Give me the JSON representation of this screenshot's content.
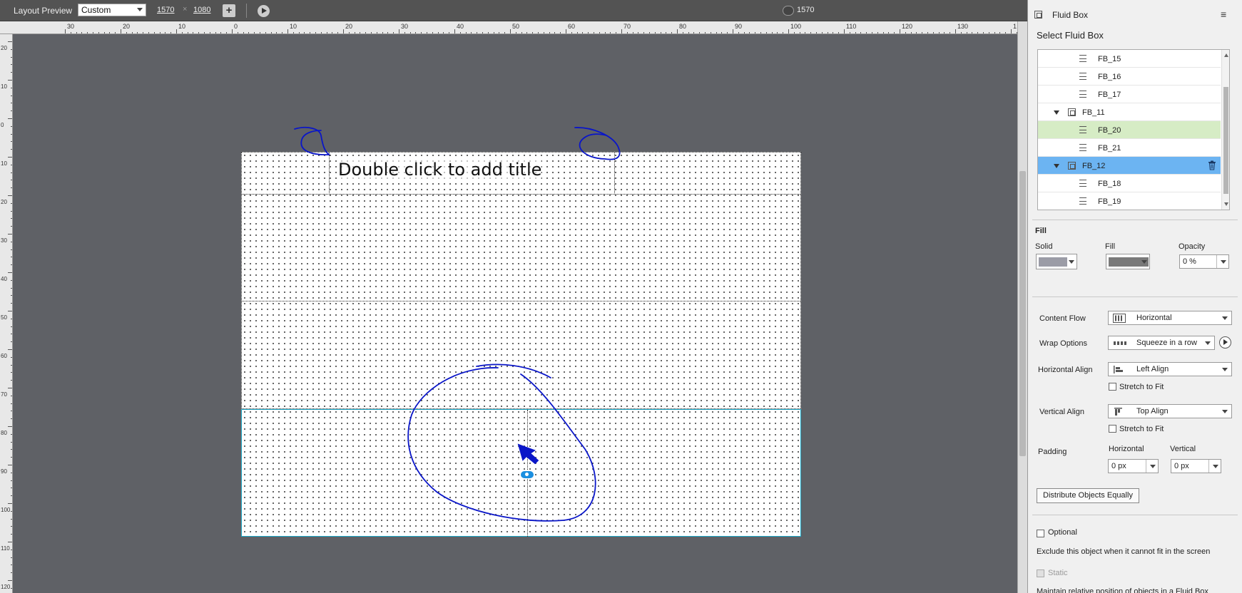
{
  "toolbar": {
    "label": "Layout Preview",
    "preset": "Custom",
    "width": "1570",
    "height": "1080",
    "separator": "×",
    "preview_width": "1570"
  },
  "rulers": {
    "top": [
      "30",
      "20",
      "10",
      "0",
      "10",
      "20",
      "30",
      "40",
      "50",
      "60",
      "70",
      "80",
      "90",
      "100",
      "110",
      "120",
      "130",
      "1"
    ],
    "left": [
      "20",
      "10",
      "0",
      "10",
      "20",
      "30",
      "40",
      "50",
      "60",
      "70",
      "80",
      "90",
      "100",
      "110",
      "120"
    ]
  },
  "canvas": {
    "title_placeholder": "Double click to add title"
  },
  "panel": {
    "title": "Fluid Box",
    "section_title": "Select Fluid Box",
    "tree": [
      {
        "label": "FB_15",
        "level": 2,
        "type": "row"
      },
      {
        "label": "FB_16",
        "level": 2,
        "type": "row"
      },
      {
        "label": "FB_17",
        "level": 2,
        "type": "row"
      },
      {
        "label": "FB_11",
        "level": 1,
        "type": "box",
        "expanded": true
      },
      {
        "label": "FB_20",
        "level": 2,
        "type": "row",
        "highlighted": true
      },
      {
        "label": "FB_21",
        "level": 2,
        "type": "row"
      },
      {
        "label": "FB_12",
        "level": 1,
        "type": "box",
        "expanded": true,
        "selected": true
      },
      {
        "label": "FB_18",
        "level": 2,
        "type": "row"
      },
      {
        "label": "FB_19",
        "level": 2,
        "type": "row"
      }
    ],
    "fill": {
      "heading": "Fill",
      "solid_label": "Solid",
      "fill_label": "Fill",
      "opacity_label": "Opacity",
      "opacity_value": "0 %",
      "solid_color": "#9b9ca6",
      "fill_color": "#7a7a7a"
    },
    "content_flow": {
      "label": "Content Flow",
      "value": "Horizontal"
    },
    "wrap_options": {
      "label": "Wrap Options",
      "value": "Squeeze in a row"
    },
    "horizontal_align": {
      "label": "Horizontal Align",
      "value": "Left Align",
      "stretch": "Stretch to Fit"
    },
    "vertical_align": {
      "label": "Vertical Align",
      "value": "Top Align",
      "stretch": "Stretch to Fit"
    },
    "padding": {
      "label": "Padding",
      "horizontal_label": "Horizontal",
      "vertical_label": "Vertical",
      "horizontal_value": "0 px",
      "vertical_value": "0 px"
    },
    "distribute_button": "Distribute Objects Equally",
    "optional": {
      "label": "Optional",
      "description": "Exclude this object when it cannot fit in the screen"
    },
    "static": {
      "label": "Static",
      "description": "Maintain relative position of objects in a Fluid Box"
    }
  },
  "colors": {
    "selection_blue": "#6cb4f2",
    "highlight_green": "#d6ecc5",
    "annotation_ink": "#0a16c8",
    "ruler_accent": "#00d8ff"
  }
}
